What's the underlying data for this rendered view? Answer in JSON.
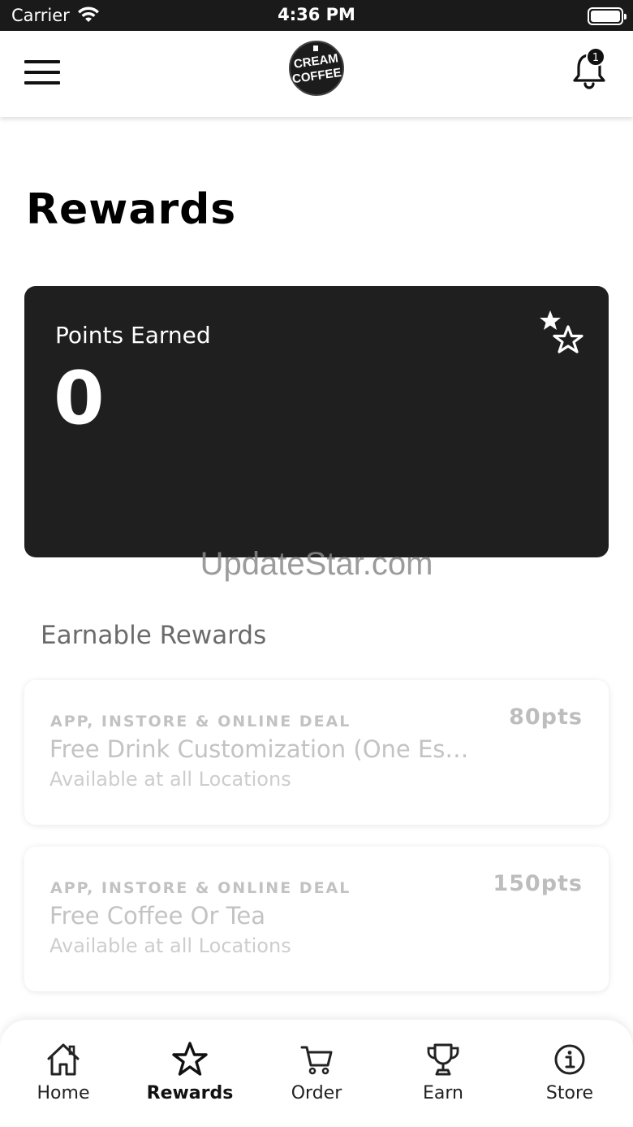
{
  "status_bar": {
    "carrier": "Carrier",
    "time": "4:36 PM"
  },
  "header": {
    "logo_text_top": "CREAM",
    "logo_text_bottom": "COFFEE",
    "notification_count": "1"
  },
  "page_title": "Rewards",
  "points_card": {
    "label": "Points Earned",
    "value": "0"
  },
  "watermark": "UpdateStar.com",
  "section_title": "Earnable Rewards",
  "rewards": [
    {
      "deal_type": "APP, INSTORE & ONLINE DEAL",
      "name": "Free Drink Customization (One Es…",
      "location": "Available at all Locations",
      "points": "80pts"
    },
    {
      "deal_type": "APP, INSTORE & ONLINE DEAL",
      "name": "Free Coffee Or Tea",
      "location": "Available at all Locations",
      "points": "150pts"
    }
  ],
  "tabs": [
    {
      "label": "Home",
      "icon": "home-icon",
      "active": false
    },
    {
      "label": "Rewards",
      "icon": "star-icon",
      "active": true
    },
    {
      "label": "Order",
      "icon": "cart-icon",
      "active": false
    },
    {
      "label": "Earn",
      "icon": "trophy-icon",
      "active": false
    },
    {
      "label": "Store",
      "icon": "info-icon",
      "active": false
    }
  ],
  "colors": {
    "card_background": "#1f1f20",
    "status_bar": "#1a1a1a",
    "muted_text": "#c3c3c3"
  }
}
